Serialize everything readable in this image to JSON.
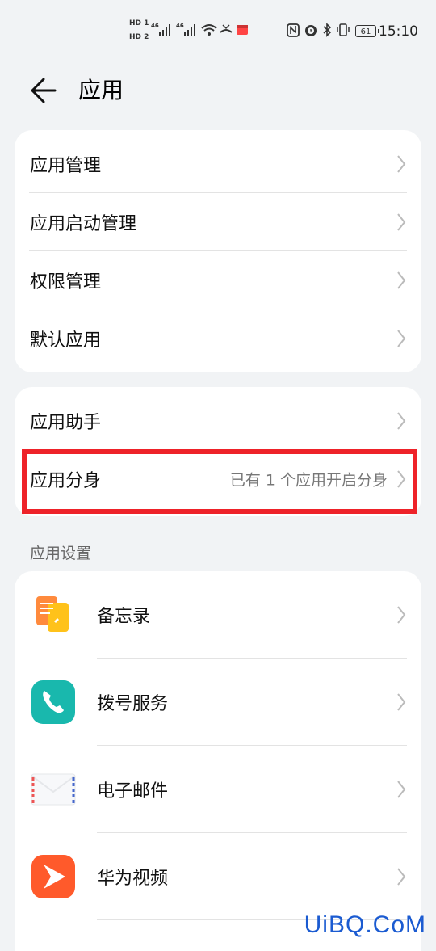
{
  "status_bar": {
    "time": "15:10",
    "battery": "61",
    "sim1": "HD 1",
    "sim2": "HD 2",
    "net1": "46",
    "net2": "46"
  },
  "header": {
    "title": "应用"
  },
  "group1": [
    {
      "label": "应用管理"
    },
    {
      "label": "应用启动管理"
    },
    {
      "label": "权限管理"
    },
    {
      "label": "默认应用"
    }
  ],
  "group2": [
    {
      "label": "应用助手"
    },
    {
      "label": "应用分身",
      "value": "已有 1 个应用开启分身"
    }
  ],
  "section_title": "应用设置",
  "apps": [
    {
      "label": "备忘录",
      "icon": "notes-icon"
    },
    {
      "label": "拨号服务",
      "icon": "phone-icon"
    },
    {
      "label": "电子邮件",
      "icon": "mail-icon"
    },
    {
      "label": "华为视频",
      "icon": "video-icon"
    }
  ],
  "watermark": "UiBQ.CoM",
  "colors": {
    "highlight": "#ee2229",
    "background": "#f1f3f5",
    "watermark": "#1b5bd1"
  }
}
